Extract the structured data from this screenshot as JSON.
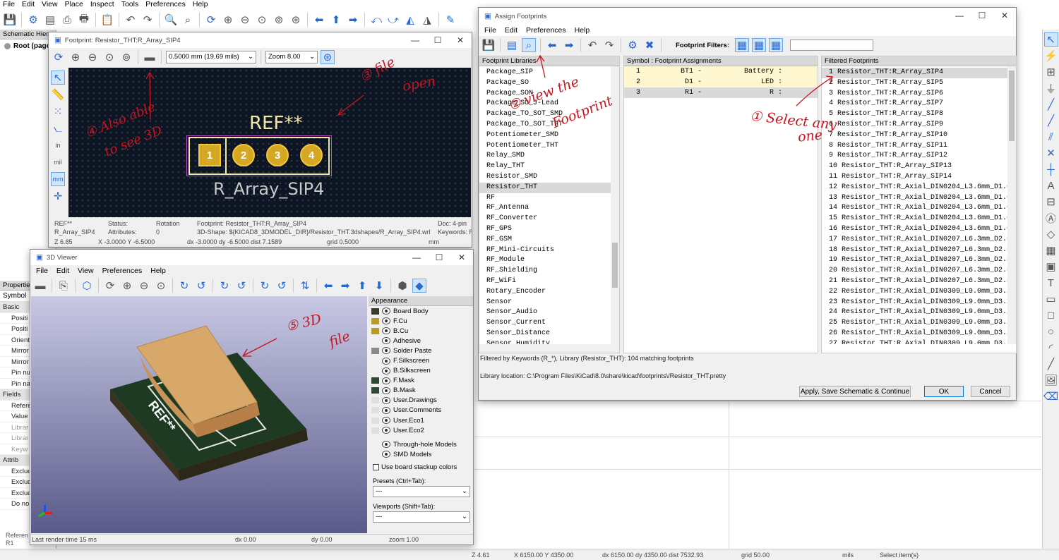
{
  "main_menu": [
    "File",
    "Edit",
    "View",
    "Place",
    "Inspect",
    "Tools",
    "Preferences",
    "Help"
  ],
  "left_panel": {
    "hierarchy_title": "Schematic Hiera",
    "root_label": "Root (page",
    "properties_title": "Properties",
    "symbol_label": "Symbol",
    "rows": [
      "Basic",
      "Positi",
      "Positi",
      "Orient",
      "Mirror",
      "Mirror",
      "Pin nu",
      "Pin na",
      "Fields",
      "Refere",
      "Value",
      "Librar",
      "Librar",
      "Keyw",
      "Attrib",
      "Exclud",
      "Exclud",
      "Exclud",
      "Do no"
    ],
    "bottom_ref": "Referen",
    "bottom_r1": "R1"
  },
  "main_status": {
    "zoom": "Z 4.61",
    "xy": "X 6150.00  Y 4350.00",
    "delta": "dx 6150.00  dy 4350.00  dist 7532.93",
    "grid": "grid 50.00",
    "units": "mils",
    "action": "Select item(s)"
  },
  "footprint_window": {
    "title": "Footprint: Resistor_THT:R_Array_SIP4",
    "grid_select": "0.5000 mm (19.69 mils)",
    "zoom_select": "Zoom 8.00",
    "ref_text": "REF**",
    "value_text": "R_Array_SIP4",
    "pads": [
      "1",
      "2",
      "3",
      "4"
    ],
    "status": {
      "ref": "REF**",
      "name": "R_Array_SIP4",
      "status_label": "Status:",
      "attributes_label": "Attributes:",
      "rotation_label": "Rotation",
      "rotation_value": "0",
      "footprint": "Footprint: Resistor_THT:R_Array_SIP4",
      "shape3d": "3D-Shape: ${KICAD8_3DMODEL_DIR}/Resistor_THT.3dshapes/R_Array_SIP4.wrl",
      "doc": "Doc: 4-pin",
      "keywords": "Keywords: R",
      "zoom": "Z 6.85",
      "xy": "X -3.0000  Y -6.5000",
      "delta": "dx -3.0000  dy -6.5000  dist 7.1589",
      "grid": "grid 0.5000",
      "units": "mm"
    }
  },
  "viewer3d": {
    "title": "3D Viewer",
    "menu": [
      "File",
      "Edit",
      "View",
      "Preferences",
      "Help"
    ],
    "board_ref": "REF**",
    "appearance_title": "Appearance",
    "layers": [
      {
        "name": "Board Body",
        "color": "#3c3a2a"
      },
      {
        "name": "F.Cu",
        "color": "#b89a2a"
      },
      {
        "name": "B.Cu",
        "color": "#b89a2a"
      },
      {
        "name": "Adhesive",
        "color": "#f0f0f0"
      },
      {
        "name": "Solder Paste",
        "color": "#8a8a8a"
      },
      {
        "name": "F.Silkscreen",
        "color": "#f0f0f0"
      },
      {
        "name": "B.Silkscreen",
        "color": "#f0f0f0"
      },
      {
        "name": "F.Mask",
        "color": "#2e4a35"
      },
      {
        "name": "B.Mask",
        "color": "#2e4a35"
      },
      {
        "name": "User.Drawings",
        "color": "#e0e0e0"
      },
      {
        "name": "User.Comments",
        "color": "#e0e0e0"
      },
      {
        "name": "User.Eco1",
        "color": "#e0e0e0"
      },
      {
        "name": "User.Eco2",
        "color": "#e0e0e0"
      }
    ],
    "models": [
      "Through-hole Models",
      "SMD Models"
    ],
    "stackup_label": "Use board stackup colors",
    "presets_label": "Presets (Ctrl+Tab):",
    "presets_value": "---",
    "viewports_label": "Viewports (Shift+Tab):",
    "viewports_value": "---",
    "status": {
      "render": "Last render time 15 ms",
      "dx": "dx 0.00",
      "dy": "dy 0.00",
      "zoom": "zoom 1.00"
    }
  },
  "assign": {
    "title": "Assign Footprints",
    "menu": [
      "File",
      "Edit",
      "Preferences",
      "Help"
    ],
    "filters_label": "Footprint Filters:",
    "libraries_header": "Footprint Libraries",
    "libraries": [
      "Package_SIP",
      "Package_SO",
      "Package_SON",
      "Package_SO_J-Lead",
      "Package_TO_SOT_SMD",
      "Package_TO_SOT_THT",
      "Potentiometer_SMD",
      "Potentiometer_THT",
      "Relay_SMD",
      "Relay_THT",
      "Resistor_SMD",
      "Resistor_THT",
      "RF",
      "RF_Antenna",
      "RF_Converter",
      "RF_GPS",
      "RF_GSM",
      "RF_Mini-Circuits",
      "RF_Module",
      "RF_Shielding",
      "RF_WiFi",
      "Rotary_Encoder",
      "Sensor",
      "Sensor_Audio",
      "Sensor_Current",
      "Sensor_Distance",
      "Sensor_Humidity"
    ],
    "selected_library": "Resistor_THT",
    "assign_header": "Symbol : Footprint Assignments",
    "assignments": [
      {
        "n": "1",
        "ref": "BT1 -",
        "value": "Battery :"
      },
      {
        "n": "2",
        "ref": "D1 -",
        "value": "LED :"
      },
      {
        "n": "3",
        "ref": "R1 -",
        "value": "R :"
      }
    ],
    "filtered_header": "Filtered Footprints",
    "footprints": [
      "1 Resistor_THT:R_Array_SIP4",
      "2 Resistor_THT:R_Array_SIP5",
      "3 Resistor_THT:R_Array_SIP6",
      "4 Resistor_THT:R_Array_SIP7",
      "5 Resistor_THT:R_Array_SIP8",
      "6 Resistor_THT:R_Array_SIP9",
      "7 Resistor_THT:R_Array_SIP10",
      "8 Resistor_THT:R_Array_SIP11",
      "9 Resistor_THT:R_Array_SIP12",
      "10 Resistor_THT:R_Array_SIP13",
      "11 Resistor_THT:R_Array_SIP14",
      "12 Resistor_THT:R_Axial_DIN0204_L3.6mm_D1.6mm_",
      "13 Resistor_THT:R_Axial_DIN0204_L3.6mm_D1.6mm_",
      "14 Resistor_THT:R_Axial_DIN0204_L3.6mm_D1.6mm_",
      "15 Resistor_THT:R_Axial_DIN0204_L3.6mm_D1.6mm_",
      "16 Resistor_THT:R_Axial_DIN0204_L3.6mm_D1.6mm_",
      "17 Resistor_THT:R_Axial_DIN0207_L6.3mm_D2.5mm_",
      "18 Resistor_THT:R_Axial_DIN0207_L6.3mm_D2.5mm_",
      "19 Resistor_THT:R_Axial_DIN0207_L6.3mm_D2.5mm_",
      "20 Resistor_THT:R_Axial_DIN0207_L6.3mm_D2.5mm_",
      "21 Resistor_THT:R_Axial_DIN0207_L6.3mm_D2.5mm_",
      "22 Resistor_THT:R_Axial_DIN0309_L9.0mm_D3.2mm_",
      "23 Resistor_THT:R_Axial_DIN0309_L9.0mm_D3.2mm_",
      "24 Resistor_THT:R_Axial_DIN0309_L9.0mm_D3.2mm_",
      "25 Resistor_THT:R_Axial_DIN0309_L9.0mm_D3.2mm_",
      "26 Resistor_THT:R_Axial_DIN0309_L9.0mm_D3.2mm_",
      "27 Resistor_THT:R_Axial_DIN0309_L9.0mm_D3.2mm_"
    ],
    "filter_status": "Filtered by Keywords (R_*), Library (Resistor_THT): 104 matching footprints",
    "library_location": "Library location: C:\\Program Files\\KiCad\\8.0\\share\\kicad\\footprints\\/Resistor_THT.pretty",
    "apply_button": "Apply, Save Schematic & Continue",
    "ok_button": "OK",
    "cancel_button": "Cancel"
  },
  "annotations": {
    "a1_line1": "① Select any",
    "a1_line2": "one",
    "a2_line1": "② view the",
    "a2_line2": "Footprint",
    "a3_line1": "③ file",
    "a3_line2": "open",
    "a4_line1": "④ Also able",
    "a4_line2": "to see 3D",
    "a5_line1": "⑤ 3D",
    "a5_line2": "file"
  }
}
